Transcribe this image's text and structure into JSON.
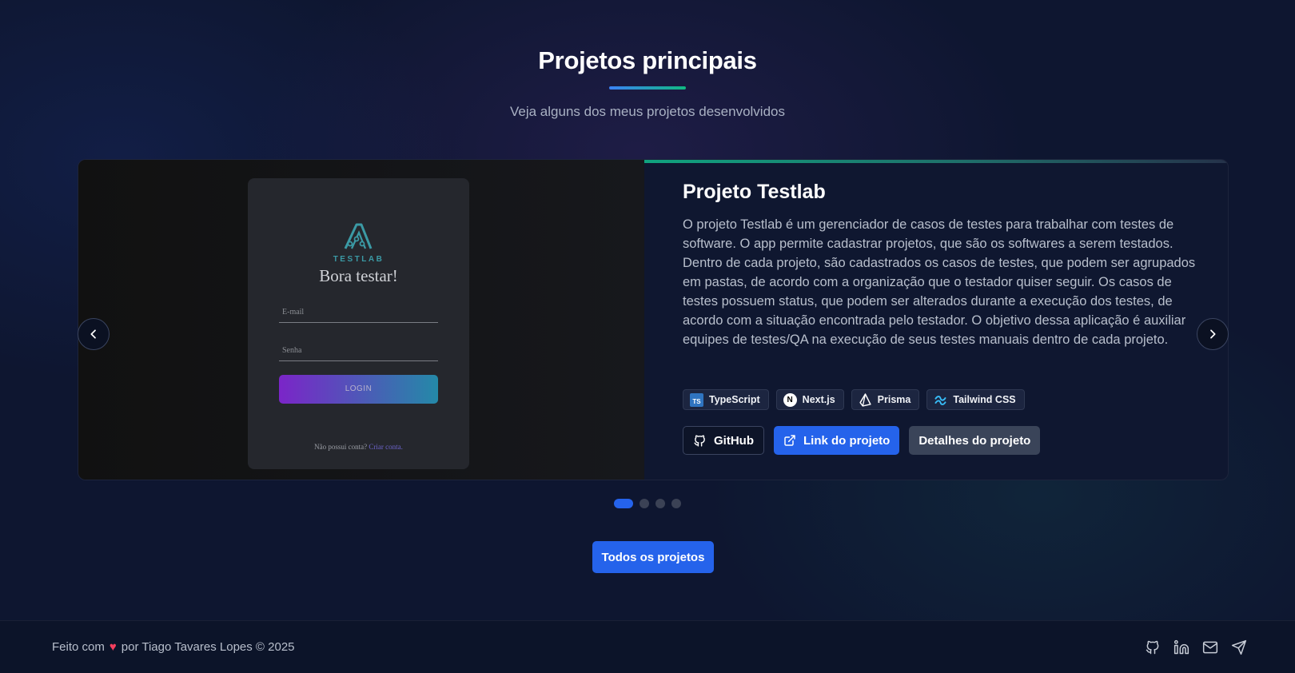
{
  "header": {
    "title": "Projetos principais",
    "subtitle": "Veja alguns dos meus projetos desenvolvidos"
  },
  "slide": {
    "mock": {
      "logo_text": "TESTLAB",
      "heading": "Bora testar!",
      "email_placeholder": "E-mail",
      "password_placeholder": "Senha",
      "login_label": "LOGIN",
      "signup_text": "Não possui conta?",
      "signup_link": "Criar conta."
    },
    "title": "Projeto Testlab",
    "description": "O projeto Testlab é um gerenciador de casos de testes para trabalhar com testes de software. O app permite cadastrar projetos, que são os softwares a serem testados. Dentro de cada projeto, são cadastrados os casos de testes, que podem ser agrupados em pastas, de acordo com a organização que o testador quiser seguir. Os casos de testes possuem status, que podem ser alterados durante a execução dos testes, de acordo com a situação encontrada pelo testador. O objetivo dessa aplicação é auxiliar equipes de testes/QA na execução de seus testes manuais dentro de cada projeto.",
    "technologies": [
      {
        "label": "TypeScript",
        "icon": "typescript-icon"
      },
      {
        "label": "Next.js",
        "icon": "nextjs-icon"
      },
      {
        "label": "Prisma",
        "icon": "prisma-icon"
      },
      {
        "label": "Tailwind CSS",
        "icon": "tailwind-icon"
      }
    ],
    "buttons": {
      "github": "GitHub",
      "link": "Link do projeto",
      "details": "Detalhes do projeto"
    }
  },
  "carousel": {
    "total_slides": 4,
    "active_index": 0
  },
  "all_projects_label": "Todos os projetos",
  "footer": {
    "made_with": "Feito com",
    "by": "por Tiago Tavares Lopes © 2025",
    "social": [
      "github-icon",
      "linkedin-icon",
      "mail-icon",
      "send-icon"
    ]
  },
  "colors": {
    "accent_blue": "#2563eb",
    "accent_green": "#10b981",
    "heart": "#f43f5e"
  }
}
